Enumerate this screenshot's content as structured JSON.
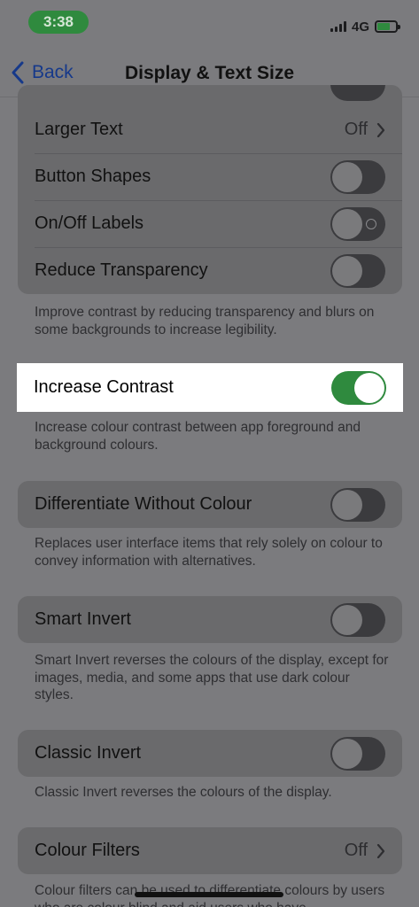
{
  "status_bar": {
    "time": "3:38",
    "network": "4G"
  },
  "nav": {
    "back_label": "Back",
    "title": "Display & Text Size"
  },
  "groups": {
    "text": {
      "larger_text": {
        "label": "Larger Text",
        "value": "Off"
      },
      "button_shapes": {
        "label": "Button Shapes",
        "on": false
      },
      "onoff_labels": {
        "label": "On/Off Labels",
        "on": false
      },
      "reduce_transparency": {
        "label": "Reduce Transparency",
        "on": false
      },
      "footnote": "Improve contrast by reducing transparency and blurs on some backgrounds to increase legibility."
    },
    "increase_contrast": {
      "label": "Increase Contrast",
      "on": true,
      "footnote": "Increase colour contrast between app foreground and background colours."
    },
    "differentiate": {
      "label": "Differentiate Without Colour",
      "on": false,
      "footnote": "Replaces user interface items that rely solely on colour to convey information with alternatives."
    },
    "smart_invert": {
      "label": "Smart Invert",
      "on": false,
      "footnote": "Smart Invert reverses the colours of the display, except for images, media, and some apps that use dark colour styles."
    },
    "classic_invert": {
      "label": "Classic Invert",
      "on": false,
      "footnote": "Classic Invert reverses the colours of the display."
    },
    "colour_filters": {
      "label": "Colour Filters",
      "value": "Off",
      "footnote": "Colour filters can be used to differentiate colours by users who are colour blind and aid users who have"
    }
  },
  "colors": {
    "accent": "#16398a",
    "toggle_on": "#2f8a3e",
    "overlay": "#7b7b7e"
  }
}
